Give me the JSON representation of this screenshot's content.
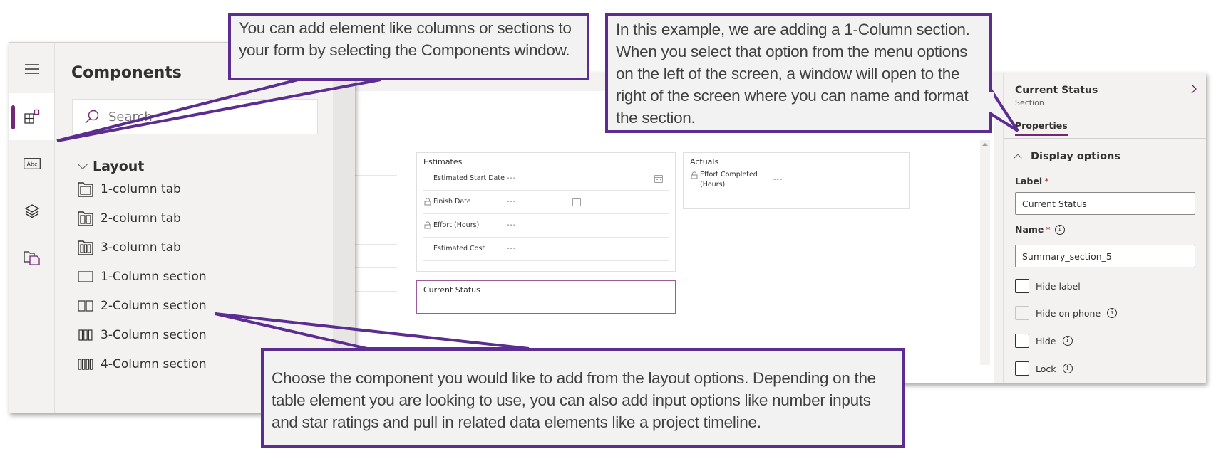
{
  "components_panel": {
    "title": "Components",
    "search_placeholder": "Search",
    "rail_icons": [
      {
        "name": "hamburger-menu-icon"
      },
      {
        "name": "components-icon",
        "active": true
      },
      {
        "name": "text-field-icon",
        "glyph_text": "Abc"
      },
      {
        "name": "layers-icon"
      },
      {
        "name": "form-libraries-icon"
      }
    ],
    "layout_group": {
      "label": "Layout",
      "items": [
        {
          "label": "1-column tab",
          "icon": "1-column-tab-icon"
        },
        {
          "label": "2-column tab",
          "icon": "2-column-tab-icon"
        },
        {
          "label": "3-column tab",
          "icon": "3-column-tab-icon"
        },
        {
          "label": "1-Column section",
          "icon": "1-column-section-icon"
        },
        {
          "label": "2-Column section",
          "icon": "2-column-section-icon"
        },
        {
          "label": "3-Column section",
          "icon": "3-column-section-icon"
        },
        {
          "label": "4-Column section",
          "icon": "4-column-section-icon"
        }
      ]
    }
  },
  "form_canvas": {
    "estimates": {
      "title": "Estimates",
      "fields": [
        {
          "label": "Estimated Start Date",
          "value": "---",
          "locked": false,
          "calendar": true
        },
        {
          "label": "Finish Date",
          "value": "---",
          "locked": true,
          "calendar": true
        },
        {
          "label": "Effort (Hours)",
          "value": "---",
          "locked": true,
          "calendar": false
        },
        {
          "label": "Estimated Cost",
          "value": "---",
          "locked": false,
          "calendar": false
        }
      ]
    },
    "actuals": {
      "title": "Actuals",
      "fields": [
        {
          "label": "Effort Completed (Hours)",
          "value": "---",
          "locked": true
        }
      ]
    },
    "new_section": {
      "title": "Current Status"
    }
  },
  "properties_pane": {
    "title": "Current Status",
    "subtitle": "Section",
    "tab": "Properties",
    "group": "Display options",
    "label_field": {
      "label": "Label",
      "required_mark": "*",
      "value": "Current Status"
    },
    "name_field": {
      "label": "Name",
      "required_mark": "*",
      "value": "Summary_section_5"
    },
    "checkboxes": [
      {
        "label": "Hide label",
        "checked": false,
        "disabled": false,
        "info": false
      },
      {
        "label": "Hide on phone",
        "checked": false,
        "disabled": true,
        "info": true
      },
      {
        "label": "Hide",
        "checked": false,
        "disabled": false,
        "info": true
      },
      {
        "label": "Lock",
        "checked": false,
        "disabled": false,
        "info": true
      }
    ]
  },
  "callouts": {
    "components": "You can add element like columns or sections to your form by selecting the Components window.",
    "section": "In this example, we are adding a 1-Column section. When you select that option from the menu options on the left of the screen, a window will open to the right of the screen where you can name and format the section.",
    "layout": "Choose the component you would like to add from the layout options. Depending on the table element you are looking to use, you can also add input options like number inputs and star ratings and pull in related data elements like a project timeline."
  },
  "colors": {
    "accent": "#742774",
    "callout_border": "#5b2d90",
    "callout_fill": "#f2f2f2"
  }
}
